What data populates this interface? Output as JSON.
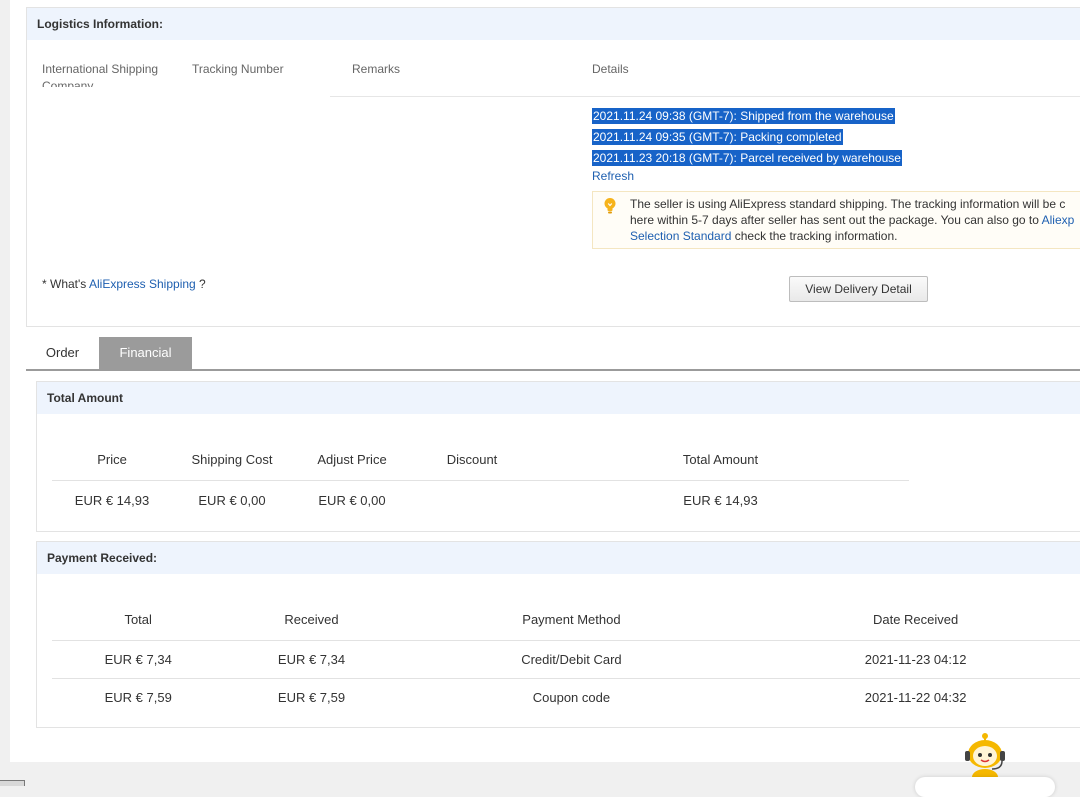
{
  "logistics": {
    "title": "Logistics Information:",
    "columns": {
      "intl": "International Shipping Company",
      "tracking": "Tracking Number",
      "remarks": "Remarks",
      "details": "Details"
    },
    "events": [
      "2021.11.24 09:38 (GMT-7): Shipped from the warehouse",
      "2021.11.24 09:35 (GMT-7): Packing completed",
      "2021.11.23 20:18 (GMT-7): Parcel received by warehouse"
    ],
    "refresh": "Refresh",
    "notice": {
      "line1": "The seller is using AliExpress standard shipping. The tracking information will be c",
      "line2_prefix": "here within 5-7 days after seller has sent out the package. You can also go to ",
      "line2_link": "Aliexp",
      "line3_link": "Selection Standard",
      "line3_suffix": " check the tracking information."
    },
    "whats_prefix": "* What's ",
    "whats_link": "AliExpress Shipping",
    "whats_suffix": " ?",
    "view_delivery": "View Delivery Detail"
  },
  "tabs": [
    "Order",
    "Financial"
  ],
  "total_amount": {
    "title": "Total Amount",
    "headers": [
      "Price",
      "Shipping Cost",
      "Adjust Price",
      "Discount",
      "Total Amount"
    ],
    "row": [
      "EUR € 14,93",
      "EUR € 0,00",
      "EUR € 0,00",
      "",
      "EUR € 14,93"
    ]
  },
  "payment": {
    "title": "Payment Received:",
    "headers": [
      "Total",
      "Received",
      "Payment Method",
      "Date Received"
    ],
    "rows": [
      [
        "EUR € 7,34",
        "EUR € 7,34",
        "Credit/Debit Card",
        "2021-11-23 04:12"
      ],
      [
        "EUR € 7,59",
        "EUR € 7,59",
        "Coupon code",
        "2021-11-22 04:32"
      ]
    ]
  },
  "colors": {
    "accent_link": "#1e5fb0",
    "highlight": "#1763c8",
    "tab_active": "#9b9b9b",
    "section_bg": "#eef4fd"
  },
  "icons": {
    "notice": "lightbulb-icon",
    "assistant": "robot-assistant-icon"
  }
}
